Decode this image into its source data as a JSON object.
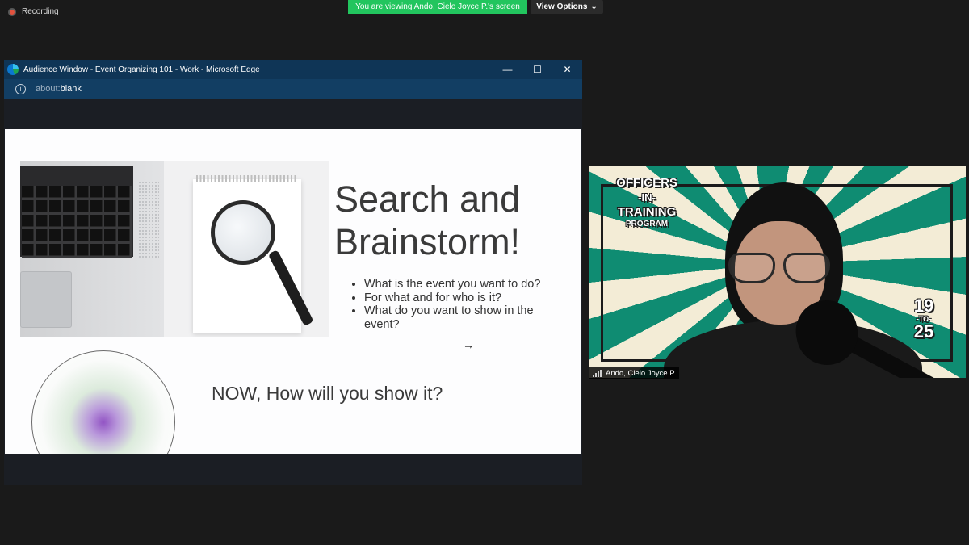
{
  "meeting": {
    "recording_label": "Recording",
    "share_banner": "You are viewing Ando, Cielo Joyce P.'s screen",
    "view_options_label": "View Options",
    "view_options_caret": "⌄"
  },
  "browser": {
    "title": "Audience Window - Event Organizing 101 - Work - Microsoft Edge",
    "url_scheme": "about:",
    "url_path": "blank",
    "info_glyph": "i",
    "controls": {
      "minimize": "—",
      "maximize": "☐",
      "close": "✕"
    }
  },
  "slide": {
    "title_line1": "Search and",
    "title_line2": "Brainstorm!",
    "bullets": [
      "What is the event you want to do?",
      "For what and for who is it?",
      "What do you want to show in the event?"
    ],
    "arrow_glyph": "→",
    "question": "NOW, How will you show it?"
  },
  "video_tile": {
    "participant_name": "Ando, Cielo Joyce P.",
    "logo_lines": [
      "OFFICERS",
      "-IN-",
      "TRAINING",
      "PROGRAM"
    ],
    "year_top": "19",
    "year_mid": "-TO-",
    "year_bottom": "25",
    "colors": {
      "ray_green": "#0f8c72",
      "ray_cream": "#f3ecd6"
    }
  },
  "colors": {
    "banner_green": "#22c55e",
    "edge_titlebar": "#0f3556",
    "edge_addressbar": "#123e63"
  }
}
